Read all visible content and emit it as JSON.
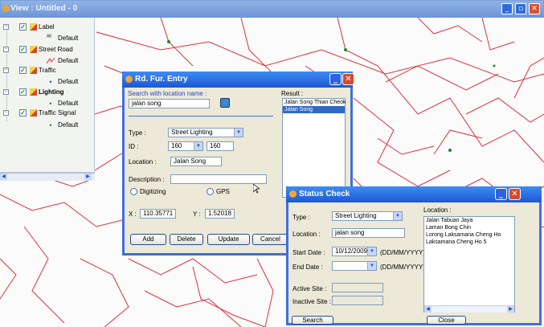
{
  "window": {
    "title": "View : Untitled - 0"
  },
  "colors": {
    "road": "#e0303a",
    "titlebar": "#2a61dc",
    "dialog_bg": "#ece9d8",
    "selection": "#316ac5"
  },
  "layers": [
    {
      "name": "Label",
      "legend": "Default",
      "icon": "label-layer-icon",
      "bold": false
    },
    {
      "name": "Street Road",
      "legend": "Default",
      "icon": "road-layer-icon",
      "bold": false
    },
    {
      "name": "Traffic",
      "legend": "Default",
      "icon": "traffic-layer-icon",
      "bold": false
    },
    {
      "name": "Lighting",
      "legend": "Default",
      "icon": "lighting-layer-icon",
      "bold": true
    },
    {
      "name": "Traffic Signal",
      "legend": "Default",
      "icon": "signal-layer-icon",
      "bold": false
    }
  ],
  "furniture_dialog": {
    "title": "Rd. Fur. Entry",
    "search_label": "Search with location name :",
    "search_value": "jalan song",
    "result_label": "Result :",
    "results": [
      "Jalan Song Thian Cheok",
      "Jalan Song"
    ],
    "selected_result_index": 1,
    "type_label": "Type :",
    "type_value": "Street Lighting",
    "id_label": "ID :",
    "id_combo_value": "160",
    "id_value": "160",
    "location_label": "Location :",
    "location_value": "Jalan Song",
    "description_label": "Description :",
    "description_value": "",
    "radio_digitizing": "Digitizing",
    "radio_gps": "GPS",
    "x_label": "X :",
    "x_value": "110.35771",
    "y_label": "Y :",
    "y_value": "1.52018",
    "buttons": {
      "add": "Add",
      "delete": "Delete",
      "update": "Update",
      "cancel": "Cancel"
    }
  },
  "status_dialog": {
    "title": "Status Check",
    "type_label": "Type :",
    "type_value": "Street Lighting",
    "location_label": "Location :",
    "location_value": "jalan song",
    "start_date_label": "Start Date :",
    "start_date_value": "10/12/2009",
    "start_date_format": "(DD/MM/YYYY)",
    "end_date_label": "End Date :",
    "end_date_value": "",
    "end_date_format": "(DD/MM/YYYY)",
    "active_site_label": "Active Site :",
    "active_site_value": "",
    "inactive_site_label": "Inactive Site :",
    "inactive_site_value": "",
    "location_list_label": "Location :",
    "locations": [
      "Jalan Tabuan Jaya",
      "Laman Bong Chin",
      "Lorong Laksamana Cheng Ho",
      "Laksamana Cheng Ho 5"
    ],
    "search_button": "Search",
    "close_button": "Close"
  }
}
